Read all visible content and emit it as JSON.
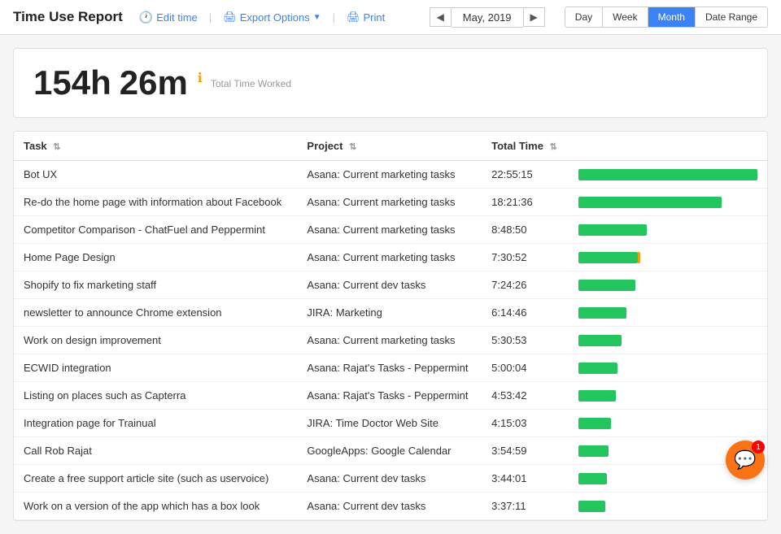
{
  "header": {
    "title": "Time Use Report",
    "edit_time_label": "Edit time",
    "export_label": "Export Options",
    "print_label": "Print",
    "current_date": "May, 2019",
    "view_tabs": [
      "Day",
      "Week",
      "Month",
      "Date Range"
    ],
    "active_tab": "Month"
  },
  "stats": {
    "hours": "154h",
    "minutes": "26m",
    "label": "Total Time Worked"
  },
  "table": {
    "columns": [
      {
        "key": "task",
        "label": "Task"
      },
      {
        "key": "project",
        "label": "Project"
      },
      {
        "key": "total_time",
        "label": "Total Time"
      }
    ],
    "rows": [
      {
        "task": "Bot UX",
        "project": "Asana: Current marketing tasks",
        "total_time": "22:55:15",
        "bar_pct": 100,
        "orange": false
      },
      {
        "task": "Re-do the home page with information about Facebook",
        "project": "Asana: Current marketing tasks",
        "total_time": "18:21:36",
        "bar_pct": 80,
        "orange": false
      },
      {
        "task": "Competitor Comparison - ChatFuel and Peppermint",
        "project": "Asana: Current marketing tasks",
        "total_time": "8:48:50",
        "bar_pct": 38,
        "orange": false
      },
      {
        "task": "Home Page Design",
        "project": "Asana: Current marketing tasks",
        "total_time": "7:30:52",
        "bar_pct": 33,
        "orange": true
      },
      {
        "task": "Shopify to fix marketing staff",
        "project": "Asana: Current dev tasks",
        "total_time": "7:24:26",
        "bar_pct": 32,
        "orange": false
      },
      {
        "task": "newsletter to announce Chrome extension",
        "project": "JIRA: Marketing",
        "total_time": "6:14:46",
        "bar_pct": 27,
        "orange": false
      },
      {
        "task": "Work on design improvement",
        "project": "Asana: Current marketing tasks",
        "total_time": "5:30:53",
        "bar_pct": 24,
        "orange": false
      },
      {
        "task": "ECWID integration",
        "project": "Asana: Rajat's Tasks - Peppermint",
        "total_time": "5:00:04",
        "bar_pct": 22,
        "orange": false
      },
      {
        "task": "Listing on places such as Capterra",
        "project": "Asana: Rajat's Tasks - Peppermint",
        "total_time": "4:53:42",
        "bar_pct": 21,
        "orange": false
      },
      {
        "task": "Integration page for Trainual",
        "project": "JIRA: Time Doctor Web Site",
        "total_time": "4:15:03",
        "bar_pct": 18,
        "orange": false
      },
      {
        "task": "Call Rob Rajat",
        "project": "GoogleApps: Google Calendar",
        "total_time": "3:54:59",
        "bar_pct": 17,
        "orange": false
      },
      {
        "task": "Create a free support article site (such as uservoice)",
        "project": "Asana: Current dev tasks",
        "total_time": "3:44:01",
        "bar_pct": 16,
        "orange": false
      },
      {
        "task": "Work on a version of the app which has a box look",
        "project": "Asana: Current dev tasks",
        "total_time": "3:37:11",
        "bar_pct": 15,
        "orange": false
      }
    ]
  },
  "chat": {
    "badge": "1"
  }
}
